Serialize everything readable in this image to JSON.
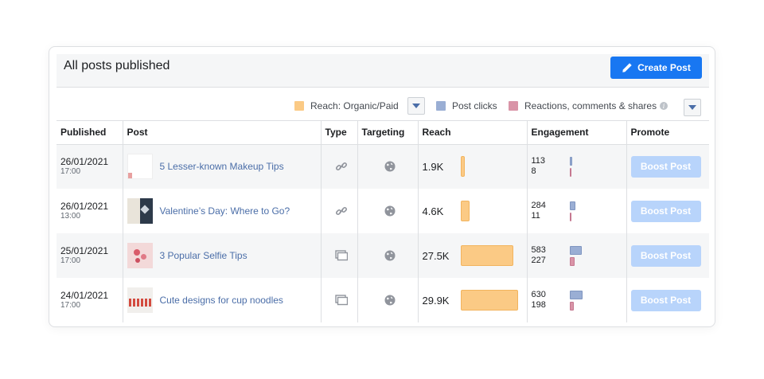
{
  "header": {
    "title": "All posts published",
    "create_post_label": "Create Post"
  },
  "legend": {
    "reach": "Reach: Organic/Paid",
    "clicks": "Post clicks",
    "reactions": "Reactions, comments & shares",
    "colors": {
      "reach": "#fbca85",
      "clicks": "#9aaed4",
      "reactions": "#d994a7"
    }
  },
  "columns": [
    "Published",
    "Post",
    "Type",
    "Targeting",
    "Reach",
    "Engagement",
    "Promote"
  ],
  "rows": [
    {
      "date": "26/01/2021",
      "time": "17:00",
      "title": "5 Lesser-known Makeup Tips",
      "type_icon": "link-icon",
      "targeting_icon": "globe-icon",
      "reach": "1.9K",
      "reach_value": 1900,
      "clicks": "113",
      "reactions": "8",
      "clicks_value": 113,
      "reactions_value": 8,
      "boost_label": "Boost Post"
    },
    {
      "date": "26/01/2021",
      "time": "13:00",
      "title": "Valentine’s Day: Where to Go?",
      "type_icon": "link-icon",
      "targeting_icon": "globe-icon",
      "reach": "4.6K",
      "reach_value": 4600,
      "clicks": "284",
      "reactions": "11",
      "clicks_value": 284,
      "reactions_value": 11,
      "boost_label": "Boost Post"
    },
    {
      "date": "25/01/2021",
      "time": "17:00",
      "title": "3 Popular Selfie Tips",
      "type_icon": "album-icon",
      "targeting_icon": "globe-icon",
      "reach": "27.5K",
      "reach_value": 27500,
      "clicks": "583",
      "reactions": "227",
      "clicks_value": 583,
      "reactions_value": 227,
      "boost_label": "Boost Post"
    },
    {
      "date": "24/01/2021",
      "time": "17:00",
      "title": "Cute designs for cup noodles",
      "type_icon": "album-icon",
      "targeting_icon": "globe-icon",
      "reach": "29.9K",
      "reach_value": 29900,
      "clicks": "630",
      "reactions": "198",
      "clicks_value": 630,
      "reactions_value": 198,
      "boost_label": "Boost Post"
    }
  ]
}
